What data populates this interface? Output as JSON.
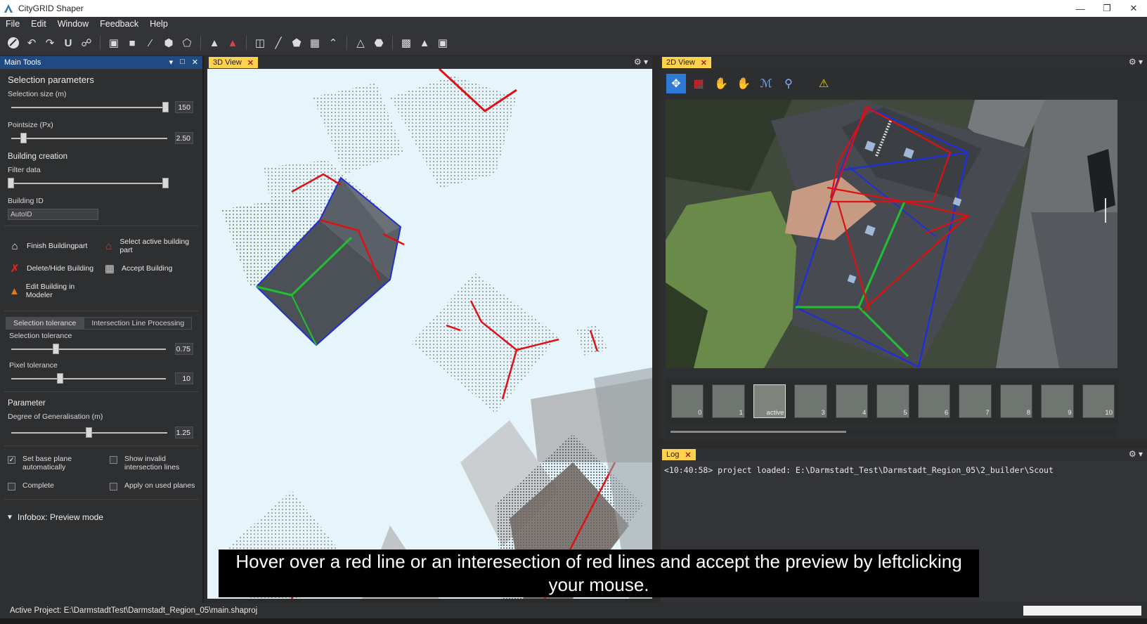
{
  "window": {
    "title": "CityGRID Shaper",
    "controls": [
      "minimize",
      "restore",
      "close"
    ]
  },
  "menu": [
    "File",
    "Edit",
    "Window",
    "Feedback",
    "Help"
  ],
  "toolbar_icons": [
    "eraser-icon",
    "undo-icon",
    "redo-icon",
    "magnet-icon",
    "link-icon",
    "select-box-icon",
    "layer-icon",
    "line-draw-icon",
    "polygon-icon",
    "pentagon-icon",
    "triangle-icon",
    "red-triangle-icon",
    "cube-icon",
    "slash-line-icon",
    "shield-shape-icon",
    "square-line-icon",
    "roof-icon",
    "peak-icon",
    "circle-shape-icon",
    "building-icon",
    "mountain-icon",
    "image-icon"
  ],
  "left_panel": {
    "title": "Main Tools",
    "selection_parameters": "Selection parameters",
    "selection_size_label": "Selection size (m)",
    "selection_size_value": "150",
    "selection_size_fraction": 0.99,
    "pointsize_label": "Pointsize (Px)",
    "pointsize_value": "2.50",
    "pointsize_fraction": 0.08,
    "building_creation": "Building creation",
    "filter_data": "Filter data",
    "building_id_label": "Building ID",
    "building_id_value": "AutoID",
    "actions": [
      {
        "icon": "house-icon",
        "label": "Finish Buildingpart"
      },
      {
        "icon": "house-red-icon",
        "label": "Select active building part"
      },
      {
        "icon": "red-x-icon",
        "label": "Delete/Hide Building"
      },
      {
        "icon": "floppy-icon",
        "label": "Accept Building"
      },
      {
        "icon": "modeler-icon",
        "label": "Edit Building in Modeler"
      }
    ],
    "tabs": [
      "Selection tolerance",
      "Intersection Line Processing"
    ],
    "selection_tolerance_label": "Selection tolerance",
    "selection_tolerance_value": "0.75",
    "selection_tolerance_fraction": 0.29,
    "pixel_tolerance_label": "Pixel tolerance",
    "pixel_tolerance_value": "10",
    "pixel_tolerance_fraction": 0.32,
    "parameter": "Parameter",
    "degree_label": "Degree of Generalisation (m)",
    "degree_value": "1.25",
    "degree_fraction": 0.5,
    "checks": [
      {
        "label": "Set base plane automatically",
        "checked": true
      },
      {
        "label": "Show invalid intersection lines",
        "checked": false
      },
      {
        "label": "Complete",
        "checked": false
      },
      {
        "label": "Apply on used planes",
        "checked": false
      }
    ],
    "infobox": "Infobox: Preview mode"
  },
  "view3d": {
    "tab": "3D View"
  },
  "view2d": {
    "tab": "2D View",
    "tools": [
      "move-icon",
      "ruler-icon",
      "hand-icon",
      "hand-red-icon",
      "picker-icon",
      "zoom-picker-icon",
      "warning-house-icon"
    ],
    "thumbnails": [
      "0",
      "1",
      "active",
      "3",
      "4",
      "5",
      "6",
      "7",
      "8",
      "9",
      "10"
    ]
  },
  "log": {
    "tab": "Log",
    "line": "<10:40:58> project loaded: E:\\Darmstadt_Test\\Darmstadt_Region_05\\2_builder\\Scout"
  },
  "subtitle": "Hover over a red line or an interesection of red lines and accept the preview by leftclicking your mouse.",
  "status": "Active Project: E:\\DarmstadtTest\\Darmstadt_Region_05\\main.shaproj",
  "colors": {
    "accent": "#1f4a82",
    "tab_active": "#ffd24d",
    "red_line": "#e0202a",
    "blue_line": "#2030d0",
    "green_line": "#20c030"
  }
}
